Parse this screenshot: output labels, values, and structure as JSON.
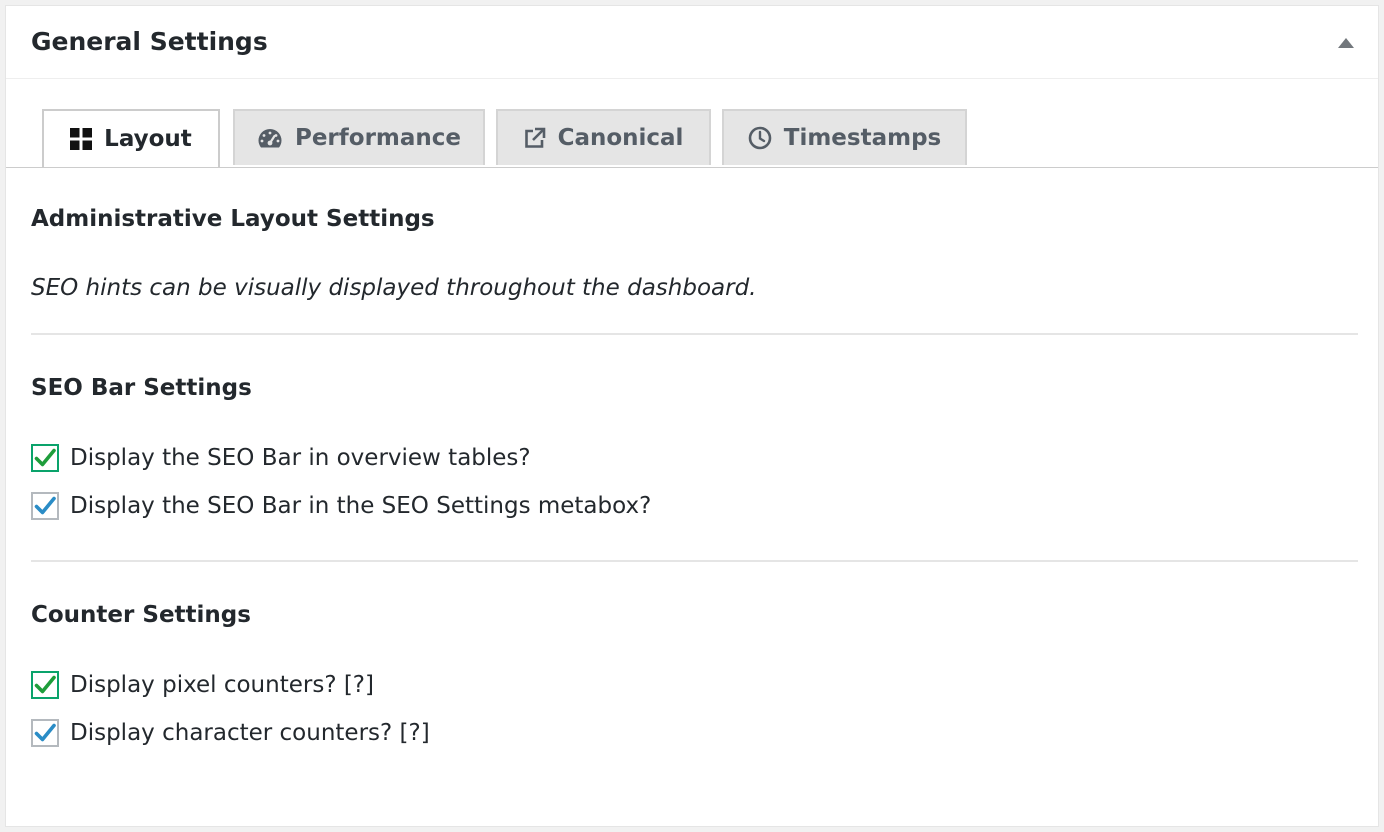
{
  "panel": {
    "title": "General Settings"
  },
  "tabs": [
    {
      "label": "Layout",
      "icon": "grid-icon",
      "active": true
    },
    {
      "label": "Performance",
      "icon": "dashboard-icon",
      "active": false
    },
    {
      "label": "Canonical",
      "icon": "external-link-icon",
      "active": false
    },
    {
      "label": "Timestamps",
      "icon": "clock-icon",
      "active": false
    }
  ],
  "sections": {
    "layout": {
      "title": "Administrative Layout Settings",
      "description": "SEO hints can be visually displayed throughout the dashboard."
    },
    "seo_bar": {
      "title": "SEO Bar Settings",
      "options": [
        {
          "label": "Display the SEO Bar in overview tables?",
          "checked": true
        },
        {
          "label": "Display the SEO Bar in the SEO Settings metabox?",
          "checked": true
        }
      ]
    },
    "counter": {
      "title": "Counter Settings",
      "options": [
        {
          "label": "Display pixel counters? [?]",
          "checked": true
        },
        {
          "label": "Display character counters? [?]",
          "checked": true
        }
      ]
    }
  },
  "colors": {
    "check_green": "#1e9d3b",
    "check_blue": "#2a8cc6",
    "active_tab_bg": "#ffffff",
    "inactive_tab_bg": "#e5e5e5"
  }
}
